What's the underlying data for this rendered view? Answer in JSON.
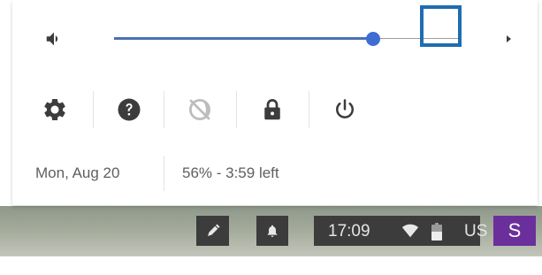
{
  "quick_settings": {
    "volume": {
      "icon": "volume-icon",
      "level_fraction": 0.75,
      "accent_color": "#3e6cd2",
      "chevron_icon": "chevron-right-icon"
    },
    "system_buttons": [
      {
        "name": "settings",
        "icon": "gear-icon"
      },
      {
        "name": "help",
        "icon": "help-icon"
      },
      {
        "name": "night-light",
        "icon": "night-light-icon",
        "state": "disabled"
      },
      {
        "name": "lock",
        "icon": "lock-icon"
      },
      {
        "name": "power",
        "icon": "power-icon"
      }
    ],
    "date": "Mon, Aug 20",
    "battery_status": "56% - 3:59 left"
  },
  "shelf": {
    "stylus_icon": "stylus-icon",
    "notification_icon": "bell-icon",
    "time": "17:09",
    "wifi_icon": "wifi-icon",
    "battery_icon": "battery-icon",
    "ime": "US",
    "avatar_initial": "S",
    "avatar_color": "#6b2f9b",
    "highlight_color": "#1f6cb0"
  }
}
